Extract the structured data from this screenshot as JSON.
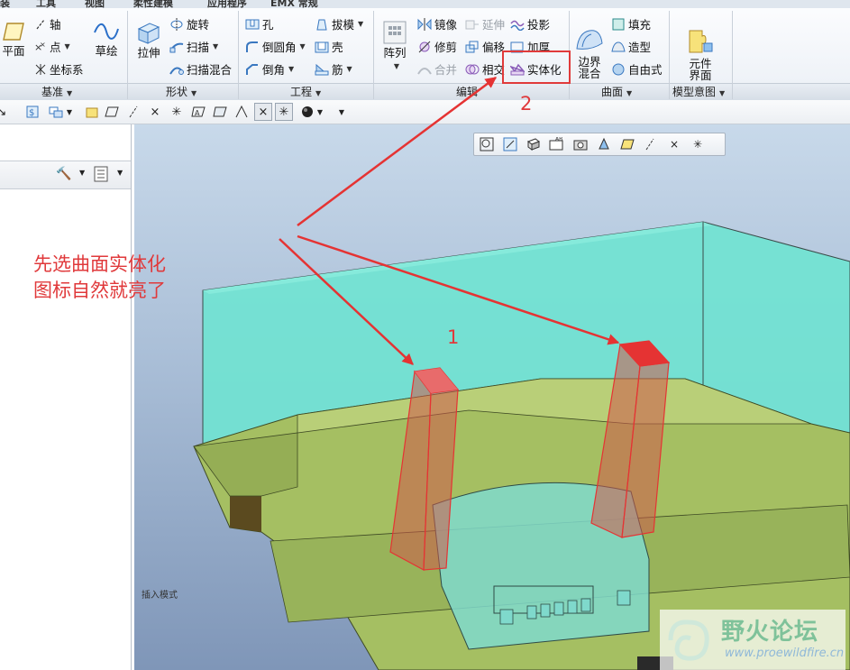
{
  "ribbon_tabs": [
    "装",
    "工具",
    "视图",
    "柔性建模",
    "应用程序",
    "EMX 常规"
  ],
  "groups": {
    "datum": {
      "label": "基准",
      "plane": "平面",
      "axis": "轴",
      "point": "点",
      "csys": "坐标系",
      "sketch": "草绘"
    },
    "shapes": {
      "label": "形状",
      "extrude": "拉伸",
      "revolve": "旋转",
      "sweep": "扫描",
      "swept_blend": "扫描混合"
    },
    "engineering": {
      "label": "工程",
      "hole": "孔",
      "round": "倒圆角",
      "chamfer": "倒角",
      "draft": "拔模",
      "shell": "壳",
      "rib": "筋"
    },
    "editing": {
      "label": "编辑",
      "pattern": "阵列",
      "mirror": "镜像",
      "trim": "修剪",
      "merge": "合并",
      "extend": "延伸",
      "offset": "偏移",
      "intersect": "相交",
      "project": "投影",
      "thicken": "加厚",
      "solidify": "实体化"
    },
    "surfaces": {
      "label": "曲面",
      "boundary_blend": "边界\n混合",
      "fill": "填充",
      "style": "造型",
      "freestyle": "自由式"
    },
    "model_intent": {
      "label": "模型意图",
      "component_interface": "元件\n界面"
    }
  },
  "annotation": {
    "note": "先选曲面实体化\n图标自然就亮了",
    "step1": "1",
    "step2": "2",
    "color": "#e0393b"
  },
  "viewport": {
    "status_text": "插入模式"
  },
  "watermark": {
    "title": "野火论坛",
    "url": "www.proewildfire.cn"
  },
  "colors": {
    "mold_transparent": "#6fe3d1",
    "part_green": "#a5bf62",
    "selected_surface": "#e53333"
  },
  "icons": [
    "plane-icon",
    "axis-icon",
    "point-icon",
    "csys-icon",
    "sketch-icon",
    "extrude-icon",
    "revolve-icon",
    "sweep-icon",
    "swept-blend-icon",
    "hole-icon",
    "round-icon",
    "chamfer-icon",
    "draft-icon",
    "shell-icon",
    "rib-icon",
    "pattern-icon",
    "mirror-icon",
    "trim-icon",
    "merge-icon",
    "extend-icon",
    "offset-icon",
    "intersect-icon",
    "project-icon",
    "thicken-icon",
    "solidify-icon",
    "boundary-blend-icon",
    "fill-icon",
    "style-icon",
    "freestyle-icon",
    "component-interface-icon"
  ]
}
